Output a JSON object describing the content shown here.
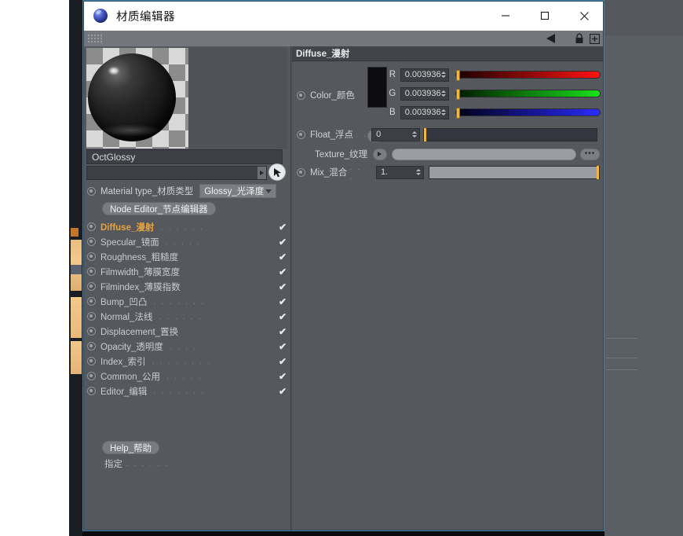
{
  "window": {
    "title": "材质编辑器",
    "app_icon": "material-sphere-icon",
    "minimize_label": "—",
    "maximize_label": "□",
    "close_label": "✕"
  },
  "toolbar": {
    "collapse_icon": "triangle-left-icon",
    "lock_icon": "padlock-icon",
    "add_icon": "plus-box-icon",
    "grip_icon": "drag-grip-icon"
  },
  "left_panel": {
    "preview_name": "material-preview",
    "name_field": {
      "value": "OctGlossy",
      "placeholder": ""
    },
    "link_field": {
      "value": "",
      "placeholder": ""
    },
    "picker_icon": "cursor-arrow-icon",
    "material_type": {
      "label": "Material type_材质类型",
      "value": "Glossy_光泽度"
    },
    "node_editor_button": "Node Editor_节点编辑器",
    "channels": [
      {
        "label": "Diffuse_漫射",
        "dots": ". . . . . .",
        "checked": "✔",
        "selected": true
      },
      {
        "label": "Specular_镜面",
        "dots": ". . . . .",
        "checked": "✔",
        "selected": false
      },
      {
        "label": "Roughness_粗糙度",
        "dots": "",
        "checked": "✔",
        "selected": false
      },
      {
        "label": "Filmwidth_薄膜宽度",
        "dots": "",
        "checked": "✔",
        "selected": false
      },
      {
        "label": "Filmindex_薄膜指数",
        "dots": "",
        "checked": "✔",
        "selected": false
      },
      {
        "label": "Bump_凹凸",
        "dots": ". . . . . . .",
        "checked": "✔",
        "selected": false
      },
      {
        "label": "Normal_法线",
        "dots": ". . . . . .",
        "checked": "✔",
        "selected": false
      },
      {
        "label": "Displacement_置换",
        "dots": "",
        "checked": "✔",
        "selected": false
      },
      {
        "label": "Opacity_透明度",
        "dots": ". . . .",
        "checked": "✔",
        "selected": false
      },
      {
        "label": "Index_索引",
        "dots": ". . . . . . . .",
        "checked": "✔",
        "selected": false
      },
      {
        "label": "Common_公用",
        "dots": ". . . . .",
        "checked": "✔",
        "selected": false
      },
      {
        "label": "Editor_编辑",
        "dots": ". . . . . . .",
        "checked": "✔",
        "selected": false
      }
    ],
    "help_button": "Help_帮助",
    "assign": {
      "label": "指定",
      "dots": ". . . . . ."
    }
  },
  "right_panel": {
    "header": "Diffuse_漫射",
    "color": {
      "label": "Color_颜色",
      "swatch_hex": "#0d0d10",
      "channels": [
        {
          "letter": "R",
          "value": "0.003936",
          "grad_class": "grad-r",
          "knob_pct": 0.4
        },
        {
          "letter": "G",
          "value": "0.003936",
          "grad_class": "grad-g",
          "knob_pct": 0.4
        },
        {
          "letter": "B",
          "value": "0.003936",
          "grad_class": "grad-b",
          "knob_pct": 0.4
        }
      ],
      "expand_icon": "triangle-right-icon"
    },
    "float": {
      "label": "Float_浮点",
      "dots": ". .",
      "value": "0",
      "knob_pct": 0
    },
    "texture": {
      "label": "Texture_纹理",
      "value": "",
      "arrow_icon": "triangle-right-icon",
      "browse_label": "•••"
    },
    "mix": {
      "label": "Mix_混合",
      "dots": ". . .",
      "value": "1.",
      "knob_pct": 100
    }
  },
  "colors": {
    "accent_selected": "#e8a33c",
    "panel_bg": "#55595e",
    "field_bg": "#3c3f43",
    "window_border": "#3f7fa8",
    "knob": "#f0b840"
  }
}
